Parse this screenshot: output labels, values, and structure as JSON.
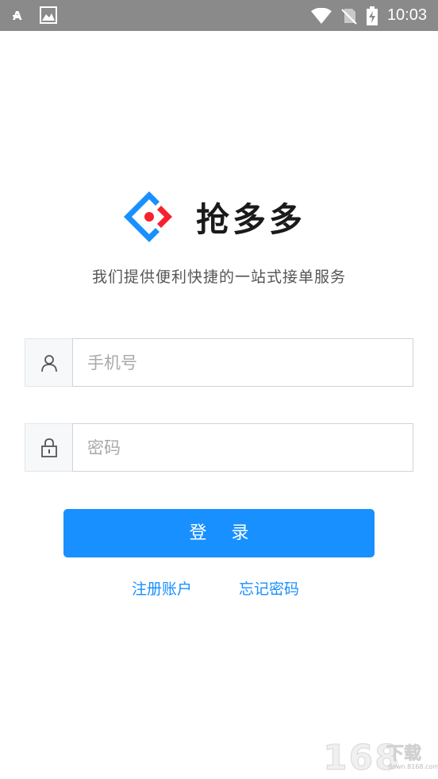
{
  "status_bar": {
    "time": "10:03",
    "icons": [
      "font-icon",
      "image-icon",
      "wifi-icon",
      "no-sim-icon",
      "battery-charging-icon"
    ]
  },
  "brand": {
    "name": "抢多多",
    "tagline": "我们提供便利快捷的一站式接单服务",
    "logo_colors": [
      "#1890ff",
      "#f5222d"
    ]
  },
  "form": {
    "phone": {
      "icon": "user-icon",
      "placeholder": "手机号",
      "value": ""
    },
    "password": {
      "icon": "lock-icon",
      "placeholder": "密码",
      "value": ""
    },
    "login_label": "登 录"
  },
  "links": {
    "register": "注册账户",
    "forgot": "忘记密码"
  },
  "watermark": {
    "digits": "168",
    "text": "下载",
    "url": "down.8168.com"
  },
  "colors": {
    "accent": "#1890ff",
    "status_bar": "#8a8a8a"
  }
}
